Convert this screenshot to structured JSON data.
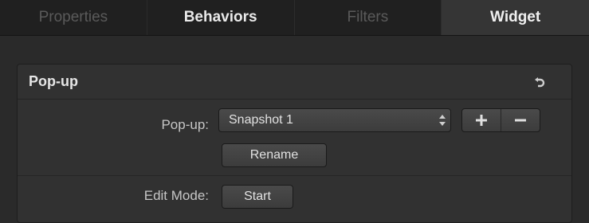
{
  "tabs": [
    {
      "label": "Properties"
    },
    {
      "label": "Behaviors"
    },
    {
      "label": "Filters"
    },
    {
      "label": "Widget"
    }
  ],
  "panel": {
    "title": "Pop-up",
    "popup_label": "Pop-up:",
    "popup_value": "Snapshot 1",
    "rename_label": "Rename",
    "edit_mode_label": "Edit Mode:",
    "start_label": "Start"
  },
  "icons": {
    "reset": "reset-arrow-icon",
    "select_arrows": "up-down-arrows-icon",
    "add": "plus-icon",
    "remove": "minus-icon"
  }
}
